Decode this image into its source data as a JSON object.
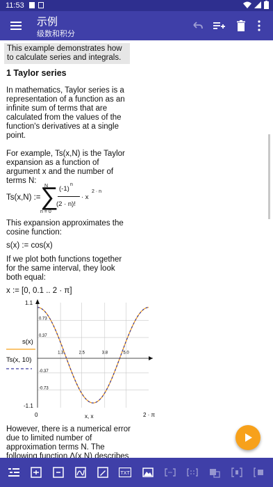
{
  "status": {
    "time": "11:53"
  },
  "appbar": {
    "title": "示例",
    "subtitle": "级数和积分"
  },
  "doc": {
    "highlight": "This example demonstrates how to calculate series and integrals.",
    "section_title": "1  Taylor series",
    "p1": "In mathematics, Taylor series is a representation of a function as an infinite sum of terms that are calculated from the values of the function's derivatives at a single point.",
    "p2": "For example, Ts(x,N) is the Taylor expansion as a function of argument x and the number of terms N:",
    "p3": "This expansion approximates the cosine function:",
    "p4": "If we plot both functions together for the same interval, they look both equal:",
    "p5": "However, there is a numerical error due to limited number of approximation terms N. The following function Δ(x,N) describes this error:",
    "f_ts": "Ts(x,N) :=",
    "f_sum_top": "N",
    "f_sum_bottom": "n = 0",
    "f_num": "(-1)",
    "f_num_exp": "n",
    "f_den": "(2 · n)!",
    "f_x": "· x",
    "f_x_exp": "2 · n",
    "f_s": "s(x) := cos(x)",
    "f_x_range": "x := [0, 0.1 .. 2 · π]"
  },
  "plot": {
    "y_max": "1.1",
    "y_min": "-1.1",
    "x_min": "0",
    "x_max": "2 · π",
    "x_label": "x, x",
    "legend_s": "s(x)",
    "legend_ts": "Ts(x, 10)",
    "grid_labels_y": [
      "0.73",
      "0.37",
      "-0.37",
      "-0.73"
    ],
    "grid_labels_x": [
      "1.3",
      "2.5",
      "3.8",
      "5.0"
    ]
  },
  "chart_data": {
    "type": "line",
    "x_range": [
      0,
      6.283
    ],
    "ylim": [
      -1.1,
      1.1
    ],
    "series": [
      {
        "name": "s(x)",
        "function": "cos(x)",
        "color": "#f7a11b"
      },
      {
        "name": "Ts(x, 10)",
        "function": "Taylor series of cos, 10 terms",
        "color": "#3a3aa0",
        "style": "dashed"
      }
    ],
    "xlabel": "x, x",
    "x_ticks": [
      "1.3",
      "2.5",
      "3.8",
      "5.0"
    ],
    "y_ticks": [
      "0.73",
      "0.37",
      "-0.37",
      "-0.73"
    ],
    "grid": true
  },
  "toolbar": {
    "items": [
      "outline",
      "text",
      "equation",
      "plot",
      "image-edit",
      "txt",
      "image",
      "snippet",
      "matrix",
      "cut",
      "brackets",
      "more"
    ],
    "txt_label": "TXT"
  },
  "colors": {
    "primary": "#3f3fa8",
    "accent": "#f7a11b",
    "status": "#2e2f8f"
  }
}
